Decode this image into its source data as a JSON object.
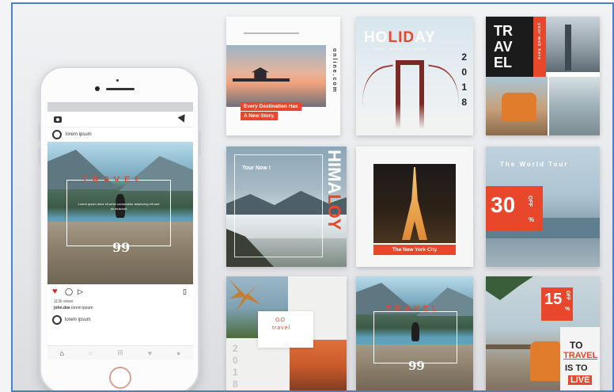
{
  "phone": {
    "username": "lorem ipsum",
    "post_title": "TRAVEL",
    "post_caption": "Lorem ipsum dolor sit amet consectetur adipiscing elit sed do eiusmod",
    "quote_glyph": "99",
    "views": "113k views",
    "caption_user": "john.doe",
    "caption_text": "lorem ipsum",
    "next_user": "lorem ipsum",
    "icons": {
      "camera": "camera-icon",
      "send": "send-icon",
      "like": "heart-icon",
      "comment": "comment-icon",
      "share": "share-icon",
      "save": "bookmark-icon",
      "home": "home-icon",
      "search": "search-icon",
      "add": "add-icon",
      "activity": "heart-outline-icon",
      "profile": "profile-icon"
    }
  },
  "cards": {
    "c1": {
      "side_text": "online.com",
      "banner_line1": "Every Destination Has",
      "banner_line2": "A New Story."
    },
    "c2": {
      "title_a": "HO",
      "title_b": "LID",
      "title_c": "AY",
      "subtitle": "your website here",
      "year": [
        "2",
        "0",
        "1",
        "8"
      ]
    },
    "c3": {
      "line1": "TR",
      "line2": "AV",
      "line3": "EL",
      "side": "your web here"
    },
    "c4": {
      "tag": "Tour Now !",
      "vertical_a": "HIMA",
      "vertical_b": "LOY"
    },
    "c5": {
      "banner": "The New York City"
    },
    "c6": {
      "title": "The World Tour",
      "percent": "30",
      "off": "OFF"
    },
    "c7": {
      "headline_a": "GO",
      "headline_b": "travel",
      "year": [
        "2",
        "0",
        "1",
        "8"
      ]
    },
    "c8": {
      "title": "TRAVEL",
      "quote_glyph": "99"
    },
    "c9": {
      "percent": "15",
      "off": "OFF",
      "line1": "TO",
      "line2": "TRAVEL",
      "line3": "IS TO",
      "line4": "LIVE"
    }
  },
  "colors": {
    "accent": "#e8472b",
    "frame_border": "#4a7fd0"
  }
}
